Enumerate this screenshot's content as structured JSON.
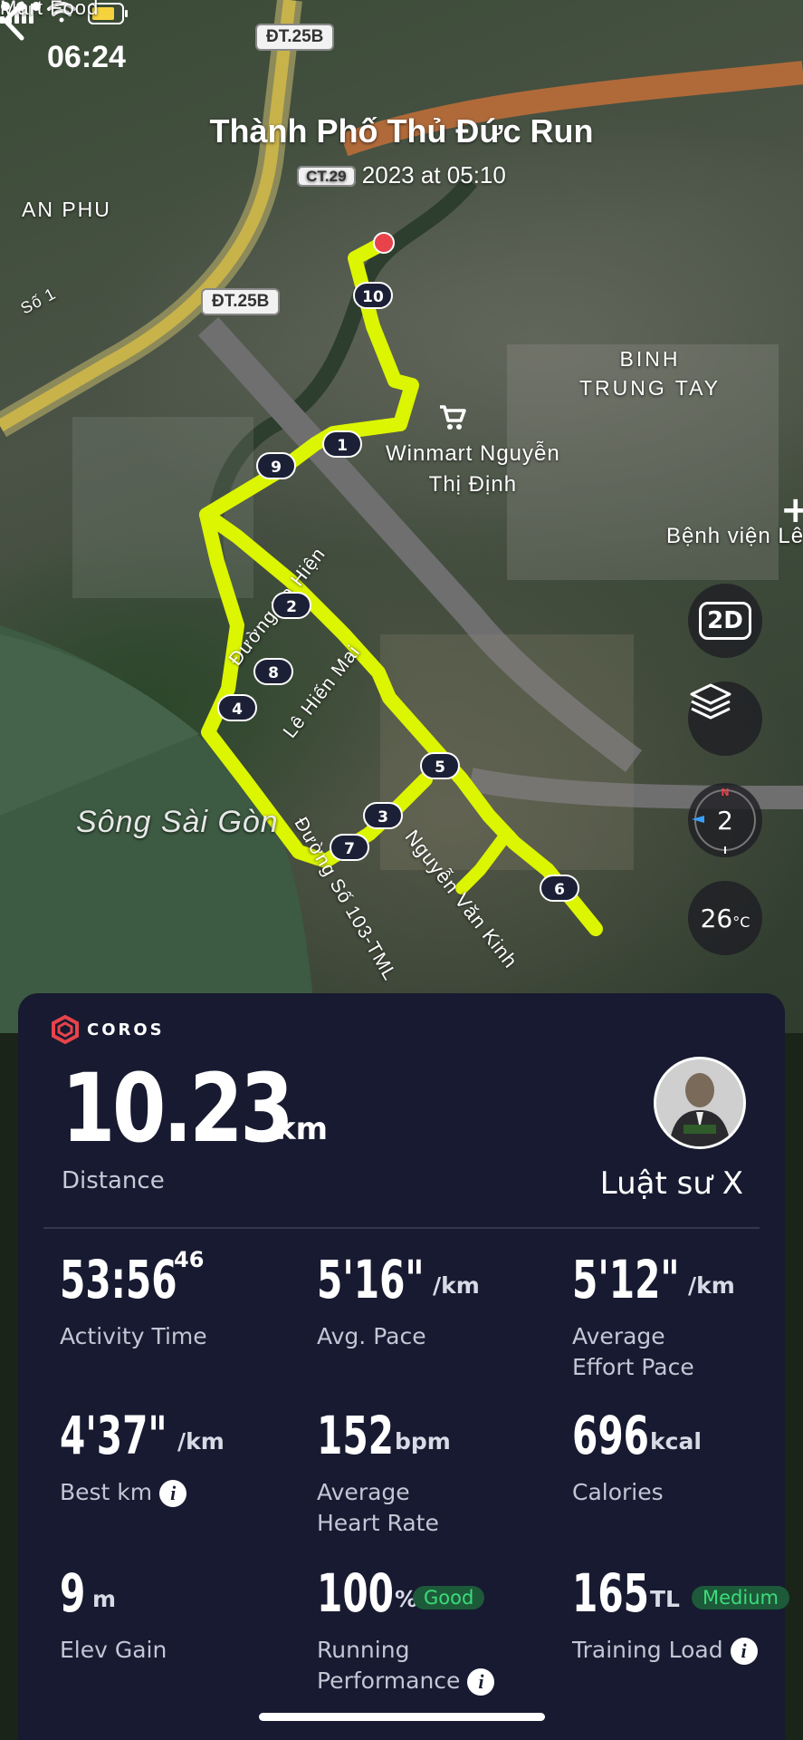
{
  "status_bar": {
    "time": "06:24"
  },
  "header": {
    "title": "Thành Phố Thủ Đức Run",
    "date_prefix": "CT.29",
    "subtitle": "2023 at 05:10"
  },
  "map": {
    "road_tags": [
      "ĐT.25B",
      "ĐT.25B"
    ],
    "partial_label": "Mart Food",
    "labels": {
      "an_phu": "AN PHU",
      "so1": "Số 1",
      "binh_trung_tay": "BINH\nTRUNG TAY",
      "winmart": "Winmart Nguyễn\nThị Định",
      "benh_vien": "Bệnh viện Lê",
      "song_sai_gon": "Sông Sài Gòn",
      "ta_hien": "Đường Tạ Hiện",
      "le_hien_mai": "Lê Hiến Mai",
      "duong_so_103": "Đường Số 103-TML",
      "nguyen_van_kinh": "Nguyễn Văn Kinh"
    },
    "km_markers": [
      "1",
      "2",
      "3",
      "4",
      "5",
      "6",
      "7",
      "8",
      "9",
      "10"
    ],
    "controls": {
      "view_mode": "2D",
      "compass_value": "2",
      "temperature": "26",
      "temperature_unit": "°C"
    },
    "route_color": "#dcf500"
  },
  "summary": {
    "brand": "COROS",
    "distance_value": "10.23",
    "distance_unit": "km",
    "distance_label": "Distance",
    "user_name": "Luật sư X",
    "stats": [
      {
        "value": "53:56",
        "sup": "46",
        "unit": "",
        "label": "Activity Time"
      },
      {
        "value": "5'16\"",
        "unit": "/km",
        "label": "Avg. Pace"
      },
      {
        "value": "5'12\"",
        "unit": "/km",
        "label": "Average\nEffort Pace"
      },
      {
        "value": "4'37\"",
        "unit": "/km",
        "label": "Best km"
      },
      {
        "value": "152",
        "unit": "bpm",
        "label": "Average\nHeart Rate"
      },
      {
        "value": "696",
        "unit": "kcal",
        "label": "Calories"
      },
      {
        "value": "9",
        "unit": "m",
        "label": "Elev Gain"
      },
      {
        "value": "100",
        "unit": "%",
        "badge": "Good",
        "label": "Running\nPerformance"
      },
      {
        "value": "165",
        "unit": "TL",
        "badge": "Medium",
        "label": "Training Load"
      }
    ]
  },
  "colors": {
    "panel": "#171a30",
    "badge_text": "#3ddc7a",
    "start_dot": "#e8434b"
  }
}
